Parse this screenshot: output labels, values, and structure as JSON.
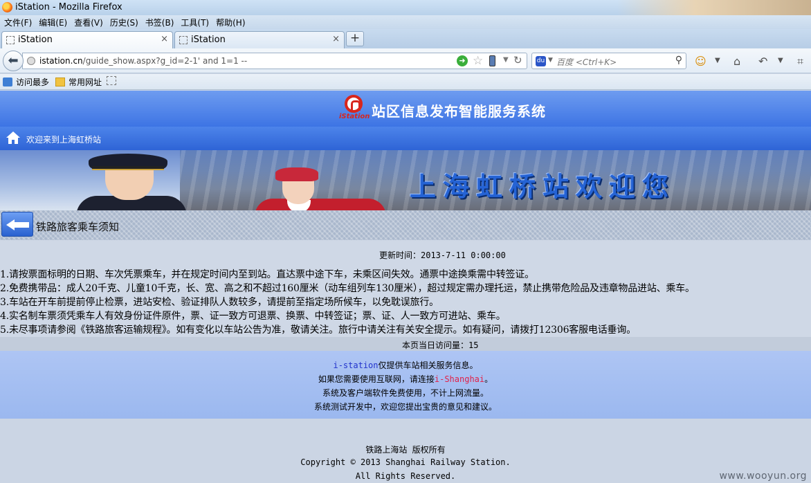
{
  "window": {
    "title": "iStation - Mozilla Firefox"
  },
  "menu": [
    "文件(F)",
    "编辑(E)",
    "查看(V)",
    "历史(S)",
    "书签(B)",
    "工具(T)",
    "帮助(H)"
  ],
  "tabs": [
    {
      "label": "iStation",
      "close": "×"
    },
    {
      "label": "iStation",
      "close": "×"
    }
  ],
  "new_tab": "+",
  "navbar": {
    "url_host": "istation.cn",
    "url_path": "/guide_show.aspx?g_id=2-1' and 1=1 --",
    "search_placeholder": "百度 <Ctrl+K>",
    "search_engine": "du"
  },
  "bookmarks": [
    "访问最多",
    "常用网址"
  ],
  "site": {
    "logo_text": "iStation",
    "title": "站区信息发布智能服务系统",
    "welcome": "欢迎来到上海虹桥站",
    "banner_text": "上海虹桥站欢迎您",
    "section_title": "铁路旅客乘车须知"
  },
  "article": {
    "updated": "更新时间：2013-7-11 0:00:00",
    "rules": [
      "1.请按票面标明的日期、车次凭票乘车，并在规定时间内至到站。直达票中途下车，未乘区间失效。通票中途换乘需中转签证。",
      "2.免费携带品：成人20千克、儿童10千克，长、宽、高之和不超过160厘米（动车组列车130厘米），超过规定需办理托运，禁止携带危险品及违章物品进站、乘车。",
      "3.车站在开车前提前停止检票，进站安检、验证排队人数较多，请提前至指定场所候车，以免耽误旅行。",
      "4.实名制车票须凭乘车人有效身份证件原件，票、证一致方可退票、换票、中转签证；票、证、人一致方可进站、乘车。",
      "5.未尽事项请参阅《铁路旅客运输规程》。如有变化以车站公告为准，敬请关注。旅行中请关注有关安全提示。如有疑问，请拨打12306客服电话垂询。"
    ],
    "visits": "本页当日访问量：15"
  },
  "notice": {
    "l1_brand": "i-station",
    "l1_text": "仅提供车站相关服务信息。",
    "l2_text": "如果您需要使用互联网，请连接",
    "l2_network": "i-Shanghai",
    "l2_end": "。",
    "l3": "系统及客户端软件免费使用，不计上网流量。",
    "l4": "系统测试开发中，欢迎您提出宝贵的意见和建议。"
  },
  "footer": {
    "rights_cn": "铁路上海站 版权所有",
    "copyright": "Copyright © 2013 Shanghai Railway Station.",
    "all_rights": "All Rights Reserved."
  },
  "watermark": "www.wooyun.org",
  "colors": {
    "header": "#3d74e4",
    "notice_brand": "#2233cc",
    "notice_network": "#e0224a"
  }
}
